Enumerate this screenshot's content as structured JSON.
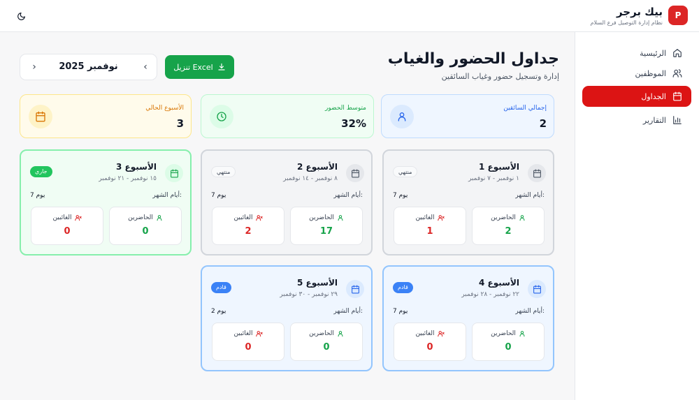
{
  "header": {
    "logo_letter": "P",
    "title": "بيك برجر",
    "subtitle": "نظام إدارة التوصيل فرع السلام",
    "theme_icon": "moon-icon"
  },
  "sidebar": {
    "items": [
      {
        "label": "الرئيسية",
        "icon": "home-icon"
      },
      {
        "label": "الموظفين",
        "icon": "users-icon"
      },
      {
        "label": "الجداول",
        "icon": "calendar-icon",
        "active": true
      },
      {
        "label": "التقارير",
        "icon": "bar-chart-icon"
      }
    ]
  },
  "page": {
    "title": "جداول الحضور والغياب",
    "subtitle": "إدارة وتسجيل حضور وغياب السائقين"
  },
  "controls": {
    "month_label": "نوفمبر 2025",
    "download_label": "تنزيل Excel",
    "prev_arrow": "‹",
    "next_arrow": "›"
  },
  "stats": [
    {
      "label": "إجمالي السائقين",
      "value": "2",
      "icon": "user-icon",
      "color": "#2563eb"
    },
    {
      "label": "متوسط الحضور",
      "value": "32%",
      "icon": "clock-icon",
      "color": "#16a34a"
    },
    {
      "label": "الأسبوع الحالي",
      "value": "3",
      "icon": "calendar-icon",
      "color": "#d97706"
    }
  ],
  "week_labels": {
    "days": "أيام الشهر:",
    "present": "الحاضرين",
    "absent": "الغائبين"
  },
  "weeks": [
    {
      "title": "الأسبوع 1",
      "range": "١ نوفمبر - ٧ نوفمبر",
      "badge": "منتهي",
      "days": "7 يوم",
      "present": "2",
      "absent": "1",
      "status": "ended"
    },
    {
      "title": "الأسبوع 2",
      "range": "٨ نوفمبر - ١٤ نوفمبر",
      "badge": "منتهي",
      "days": "7 يوم",
      "present": "17",
      "absent": "2",
      "status": "ended"
    },
    {
      "title": "الأسبوع 3",
      "range": "١٥ نوفمبر - ٢١ نوفمبر",
      "badge": "جاري",
      "days": "7 يوم",
      "present": "0",
      "absent": "0",
      "status": "current"
    },
    {
      "title": "الأسبوع 4",
      "range": "٢٢ نوفمبر - ٢٨ نوفمبر",
      "badge": "قادم",
      "days": "7 يوم",
      "present": "0",
      "absent": "0",
      "status": "upcoming"
    },
    {
      "title": "الأسبوع 5",
      "range": "٢٩ نوفمبر - ٣٠ نوفمبر",
      "badge": "قادم",
      "days": "2 يوم",
      "present": "0",
      "absent": "0",
      "status": "upcoming"
    }
  ]
}
